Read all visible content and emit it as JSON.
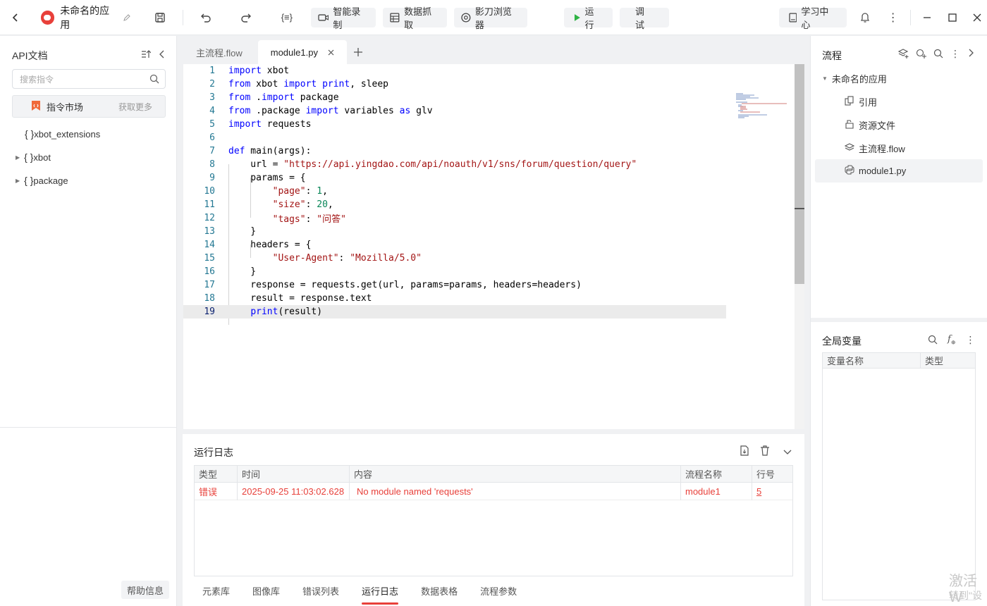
{
  "topbar": {
    "app_name": "未命名的应用",
    "smart_record": "智能录制",
    "data_grab": "数据抓取",
    "browser": "影刀浏览器",
    "run": "运行",
    "debug": "调试",
    "learn": "学习中心"
  },
  "left": {
    "title": "API文档",
    "search_placeholder": "搜索指令",
    "market": "指令市场",
    "more": "获取更多",
    "tree": [
      {
        "label": "xbot_extensions"
      },
      {
        "label": "xbot"
      },
      {
        "label": "package"
      }
    ],
    "help": "帮助信息"
  },
  "editor": {
    "tabs": [
      {
        "label": "主流程.flow"
      },
      {
        "label": "module1.py"
      }
    ],
    "line_numbers": [
      "1",
      "2",
      "3",
      "4",
      "5",
      "6",
      "7",
      "8",
      "9",
      "10",
      "11",
      "12",
      "13",
      "14",
      "15",
      "16",
      "17",
      "18",
      "19"
    ],
    "code": {
      "l1a": "import",
      "l1b": " xbot",
      "l2a": "from",
      "l2b": " xbot ",
      "l2c": "import",
      "l2d": " ",
      "l2e": "print",
      "l2f": ", sleep",
      "l3a": "from",
      "l3b": " .",
      "l3c": "import",
      "l3d": " package",
      "l4a": "from",
      "l4b": " .package ",
      "l4c": "import",
      "l4d": " variables ",
      "l4e": "as",
      "l4f": " glv",
      "l5a": "import",
      "l5b": " requests",
      "l7a": "def",
      "l7b": " main(args):",
      "l8a": "    url = ",
      "l8b": "\"https://api.yingdao.com/api/noauth/v1/sns/forum/question/query\"",
      "l9": "    params = {",
      "l10a": "        ",
      "l10b": "\"page\"",
      "l10c": ": ",
      "l10d": "1",
      "l10e": ",",
      "l11a": "        ",
      "l11b": "\"size\"",
      "l11c": ": ",
      "l11d": "20",
      "l11e": ",",
      "l12a": "        ",
      "l12b": "\"tags\"",
      "l12c": ": ",
      "l12d": "\"问答\"",
      "l13": "    }",
      "l14": "    headers = {",
      "l15a": "        ",
      "l15b": "\"User-Agent\"",
      "l15c": ": ",
      "l15d": "\"Mozilla/5.0\"",
      "l16": "    }",
      "l17": "    response = requests.get(url, params=params, headers=headers)",
      "l18": "    result = response.text",
      "l19a": "    ",
      "l19b": "print",
      "l19c": "(result)"
    }
  },
  "log": {
    "title": "运行日志",
    "columns": [
      "类型",
      "时间",
      "内容",
      "流程名称",
      "行号"
    ],
    "rows": [
      {
        "type": "错误",
        "time": "2025-09-25 11:03:02.628",
        "content": "No module named 'requests'",
        "flow": "module1",
        "line": "5"
      }
    ],
    "tabs": [
      "元素库",
      "图像库",
      "错误列表",
      "运行日志",
      "数据表格",
      "流程参数"
    ]
  },
  "right": {
    "flow_title": "流程",
    "root": "未命名的应用",
    "items": [
      {
        "label": "引用"
      },
      {
        "label": "资源文件"
      },
      {
        "label": "主流程.flow"
      },
      {
        "label": "module1.py"
      }
    ],
    "vars_title": "全局变量",
    "var_columns": [
      "变量名称",
      "类型"
    ]
  },
  "watermark": {
    "line1": "激活 W",
    "line2": "转到\"设"
  },
  "colors": {
    "accent": "#e8403a",
    "keyword": "#0000ff",
    "string": "#a31515",
    "number": "#098658",
    "line_number": "#237893"
  }
}
